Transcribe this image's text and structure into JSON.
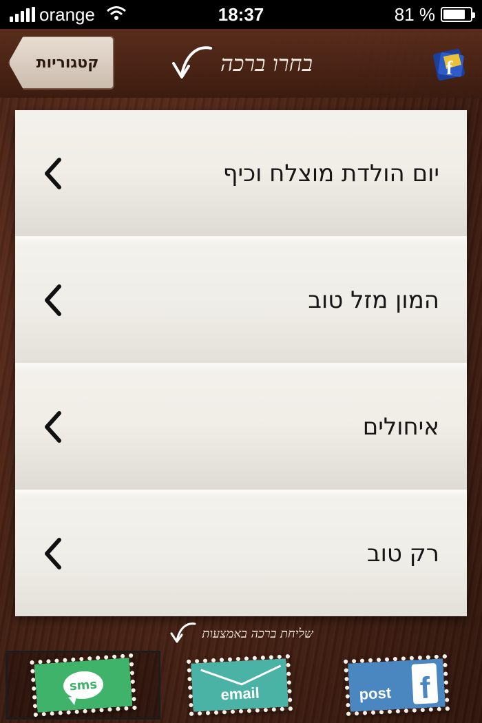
{
  "status_bar": {
    "carrier": "orange",
    "time": "18:37",
    "battery": "81 %",
    "battery_level": 0.81
  },
  "nav": {
    "back_label": "קטגוריות",
    "title": "בחרו ברכה"
  },
  "list": {
    "items": [
      {
        "label": "יום הולדת מוצלח וכיף"
      },
      {
        "label": "המון מזל טוב"
      },
      {
        "label": "איחולים"
      },
      {
        "label": "רק טוב"
      }
    ]
  },
  "share": {
    "hint": "שליחת ברכה באמצעות",
    "options": [
      {
        "label": "sms",
        "selected": true
      },
      {
        "label": "email",
        "selected": false
      },
      {
        "label": "post",
        "selected": false
      }
    ]
  },
  "colors": {
    "sms": "#3fb36a",
    "email": "#4bb3a6",
    "post": "#4a86bf",
    "wood": "#4a2315"
  },
  "icons": {
    "wifi": "wifi-icon",
    "battery": "battery-icon",
    "arrow": "swoosh-arrow-icon",
    "chevron": "chevron-left-icon",
    "logo": "app-logo-icon"
  }
}
